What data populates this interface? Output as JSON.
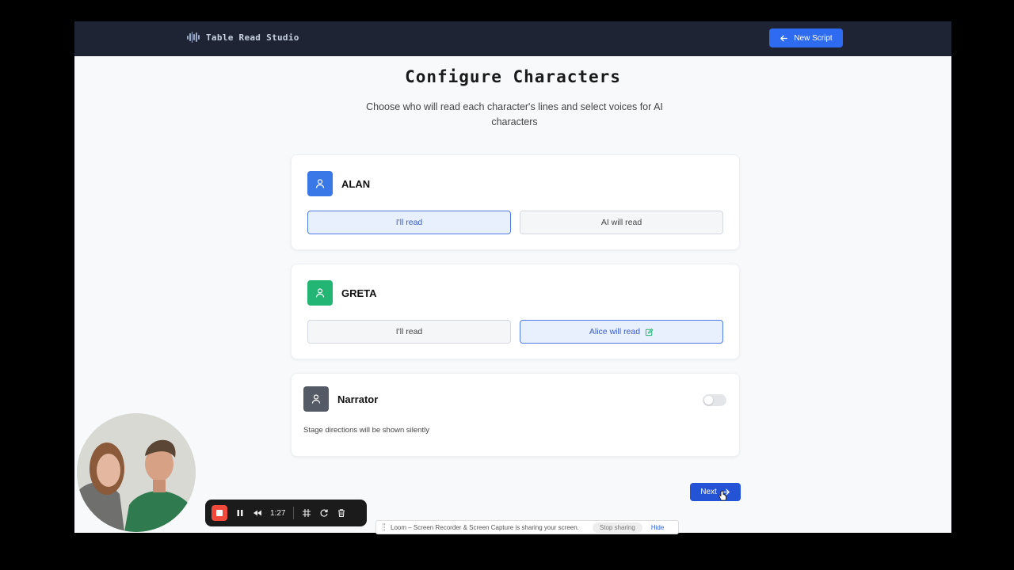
{
  "app": {
    "name": "Table Read Studio"
  },
  "header": {
    "new_script_label": "New Script"
  },
  "page": {
    "title": "Configure Characters",
    "subtitle": "Choose who will read each character's lines and select voices for AI characters"
  },
  "characters": [
    {
      "name": "ALAN",
      "avatar_color": "#3b78e7",
      "option_self": "I'll read",
      "option_other": "AI will read",
      "selected": "self"
    },
    {
      "name": "GRETA",
      "avatar_color": "#22b573",
      "option_self": "I'll read",
      "option_other": "Alice will read",
      "selected": "other"
    }
  ],
  "narrator": {
    "name": "Narrator",
    "avatar_color": "#555b66",
    "description": "Stage directions will be shown silently",
    "enabled": false
  },
  "footer": {
    "next_label": "Next"
  },
  "recorder": {
    "elapsed": "1:27"
  },
  "share_notice": {
    "message": "Loom – Screen Recorder & Screen Capture is sharing your screen.",
    "stop_label": "Stop sharing",
    "hide_label": "Hide"
  },
  "colors": {
    "accent": "#2f6bf0",
    "topbar": "#1e2433",
    "selected_border": "#4e7be6"
  }
}
